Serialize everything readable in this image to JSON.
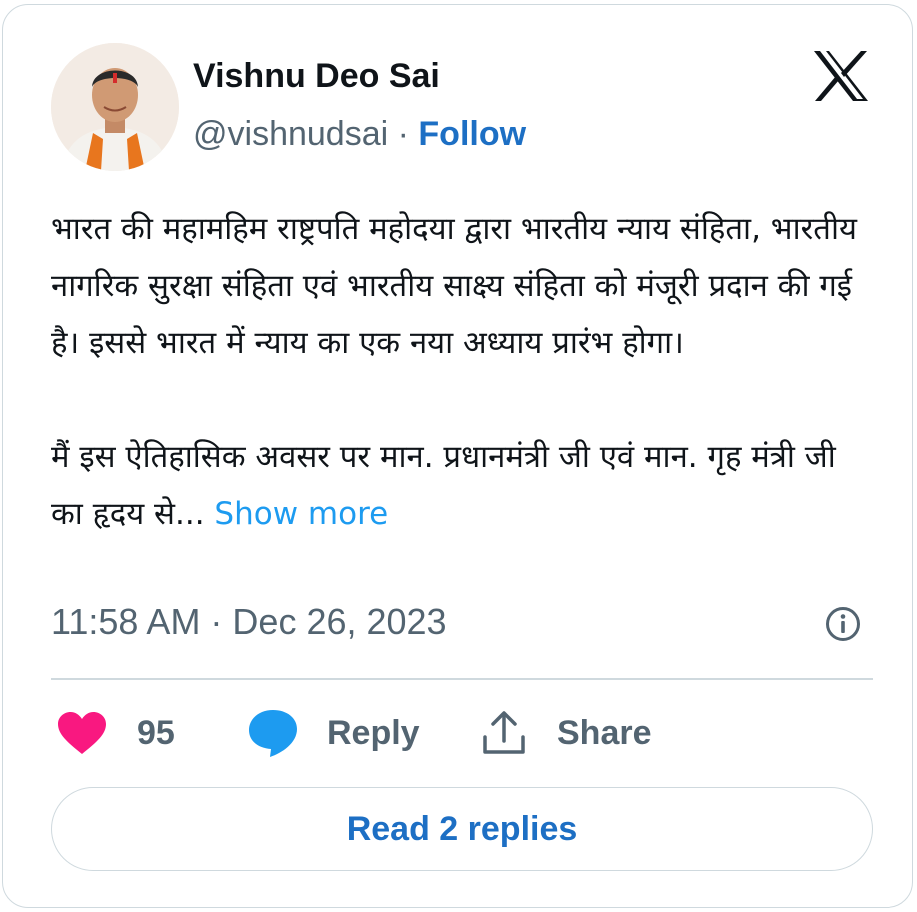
{
  "author": {
    "name": "Vishnu Deo Sai",
    "handle": "@vishnudsai",
    "separator": "·",
    "follow_label": "Follow"
  },
  "brand": {
    "icon": "x-logo-icon"
  },
  "tweet": {
    "paragraph1": "भारत की महामहिम राष्ट्रपति महोदया द्वारा भारतीय न्याय संहिता, भारतीय नागरिक सुरक्षा संहिता एवं भारतीय साक्ष्य संहिता को मंजूरी प्रदान की गई है। इससे भारत में न्याय का एक नया अध्याय प्रारंभ होगा।",
    "paragraph2": "मैं इस ऐतिहासिक अवसर पर मान. प्रधानमंत्री जी एवं मान. गृह मंत्री जी का हृदय से...",
    "show_more_label": "Show more",
    "timestamp": "11:58 AM · Dec 26, 2023"
  },
  "actions": {
    "like_count": "95",
    "reply_label": "Reply",
    "share_label": "Share"
  },
  "read_replies_label": "Read 2 replies",
  "colors": {
    "accent": "#1d9bf0",
    "follow": "#1d6fc4",
    "like": "#f91880",
    "muted": "#536471",
    "border": "#cfd9de"
  }
}
